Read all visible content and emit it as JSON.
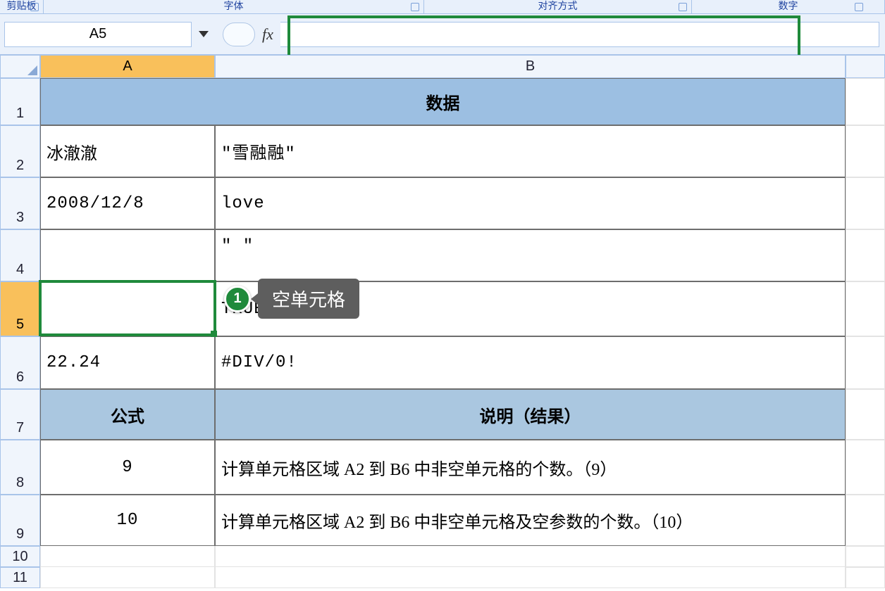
{
  "ribbon": {
    "group_clipboard": "剪贴板",
    "group_font": "字体",
    "group_alignment": "对齐方式",
    "group_number": "数字"
  },
  "namebox": {
    "value": "A5"
  },
  "fx_label": "fx",
  "formula_value": "",
  "columns": {
    "a": "A",
    "b": "B"
  },
  "rows": [
    "1",
    "2",
    "3",
    "4",
    "5",
    "6",
    "7",
    "8",
    "9",
    "10",
    "11"
  ],
  "cells": {
    "r1_merged": "数据",
    "a2": "冰澈澈",
    "b2": "\"雪融融\"",
    "a3": "2008/12/8",
    "b3": "love",
    "a4": "",
    "b4": "\"   \"",
    "a5": "",
    "b5": "TRUE",
    "a6": "22.24",
    "b6": "#DIV/0!",
    "a7": "公式",
    "b7": "说明（结果）",
    "a8": "9",
    "b8": "计算单元格区域 A2 到 B6 中非空单元格的个数。（9）",
    "a9": "10",
    "b9": "计算单元格区域 A2 到 B6 中非空单元格及空参数的个数。（10）"
  },
  "annotation": {
    "number": "1",
    "text": "空单元格"
  }
}
